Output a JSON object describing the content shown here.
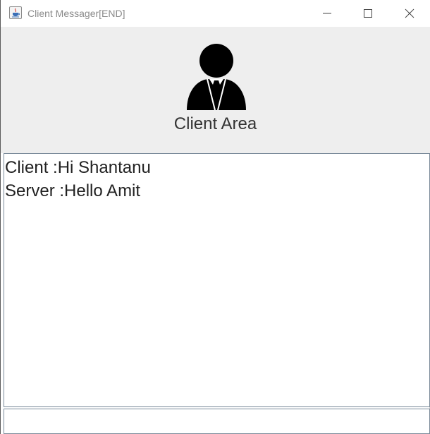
{
  "window": {
    "title": "Client Messager[END]",
    "app_icon": "java-cup-icon",
    "controls": [
      "minimize-icon",
      "maximize-icon",
      "close-icon"
    ]
  },
  "header": {
    "avatar_icon": "businessman-icon",
    "label": "Client Area"
  },
  "messages": [
    {
      "text": "Client :Hi Shantanu"
    },
    {
      "text": "Server :Hello Amit"
    }
  ],
  "input": {
    "value": "",
    "placeholder": ""
  },
  "colors": {
    "header_background": "#eeeeee",
    "title_text": "#8a8a8a",
    "border": "#7a8a99"
  }
}
